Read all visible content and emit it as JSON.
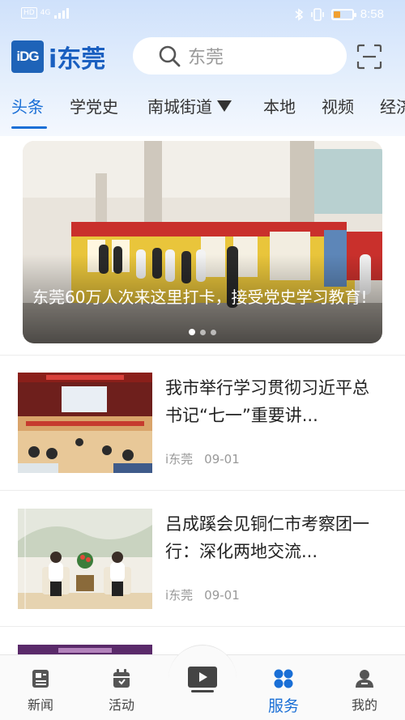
{
  "status_bar": {
    "hd": "HD",
    "network": "4G",
    "time": "8:58",
    "battery_level": 0.35
  },
  "header": {
    "logo_mark": "iDG",
    "logo_text": "i东莞",
    "search_placeholder": "东莞",
    "icons": {
      "search": "search-icon",
      "scan": "scan-icon"
    }
  },
  "tabs": [
    {
      "label": "头条",
      "active": true
    },
    {
      "label": "学党史"
    },
    {
      "label": "南城街道"
    },
    {
      "label": "本地"
    },
    {
      "label": "视频"
    },
    {
      "label": "经济"
    }
  ],
  "banner": {
    "title": "东莞60万人次来这里打卡，接受党史学习教育!",
    "slide_count": 3,
    "active_slide": 1
  },
  "news": [
    {
      "title": "我市举行学习贯彻习近平总书记“七一”重要讲...",
      "source": "i东莞",
      "date": "09-01"
    },
    {
      "title": "吕成蹊会见铜仁市考察团一行：深化两地交流...",
      "source": "i东莞",
      "date": "09-01"
    }
  ],
  "bottom_nav": [
    {
      "label": "新闻",
      "icon": "news-icon"
    },
    {
      "label": "活动",
      "icon": "calendar-icon"
    },
    {
      "label": "",
      "icon": "video-play-icon"
    },
    {
      "label": "服务",
      "icon": "services-grid-icon",
      "active": true
    },
    {
      "label": "我的",
      "icon": "user-icon"
    }
  ],
  "colors": {
    "accent": "#1a6fd6",
    "logo_blue": "#1e63b8",
    "header_gradient_top": "#cfe1fb"
  }
}
